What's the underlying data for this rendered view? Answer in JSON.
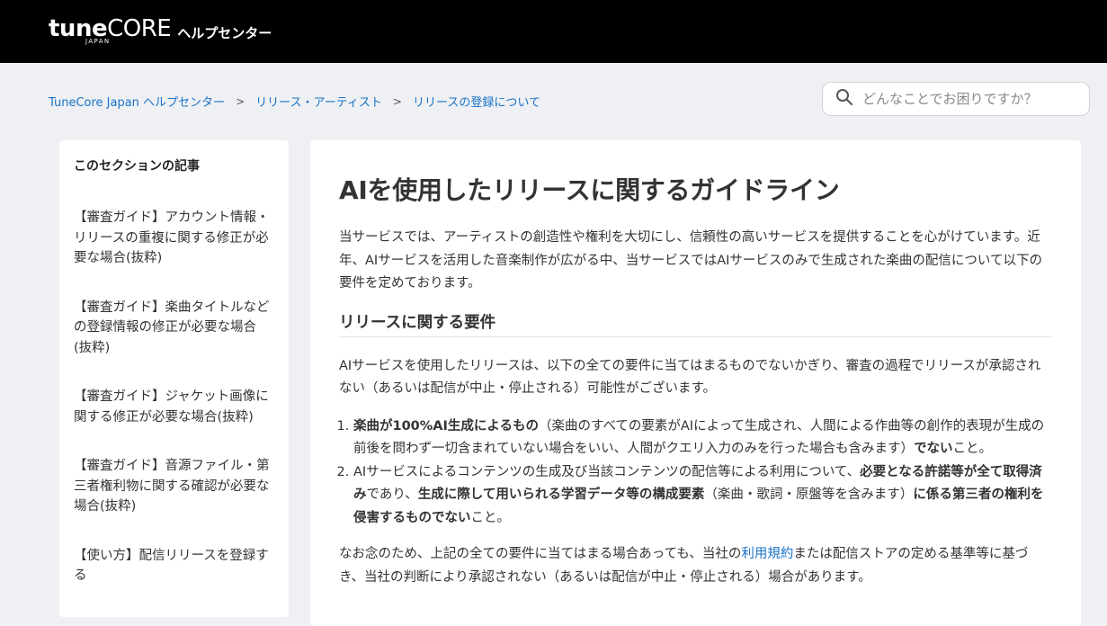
{
  "header": {
    "logo_tune": "tune",
    "logo_core": "CORE",
    "logo_japan": "JAPAN",
    "help_label": "ヘルプセンター"
  },
  "breadcrumb": [
    "TuneCore Japan ヘルプセンター",
    "リリース・アーティスト",
    "リリースの登録について"
  ],
  "breadcrumb_separator": ">",
  "search": {
    "placeholder": "どんなことでお困りですか？"
  },
  "sidebar": {
    "title": "このセクションの記事",
    "items": [
      "【審査ガイド】アカウント情報・リリースの重複に関する修正が必要な場合(抜粋)",
      "【審査ガイド】楽曲タイトルなどの登録情報の修正が必要な場合(抜粋)",
      "【審査ガイド】ジャケット画像に関する修正が必要な場合(抜粋)",
      "【審査ガイド】音源ファイル・第三者権利物に関する確認が必要な場合(抜粋)",
      "【使い方】配信リリースを登録する"
    ]
  },
  "article": {
    "title": "AIを使用したリリースに関するガイドライン",
    "intro": "当サービスでは、アーティストの創造性や権利を大切にし、信頼性の高いサービスを提供することを心がけています。近年、AIサービスを活用した音楽制作が広がる中、当サービスではAIサービスのみで生成された楽曲の配信について以下の要件を定めております。",
    "section_heading": "リリースに関する要件",
    "section_intro": "AIサービスを使用したリリースは、以下の全ての要件に当てはまるものでないかぎり、審査の過程でリリースが承認されない（あるいは配信が中止・停止される）可能性がございます。",
    "req1": {
      "bold_a": "楽曲が100%AI生成によるもの",
      "text_b": "（楽曲のすべての要素がAIによって生成され、人間による作曲等の創作的表現が生成の前後を問わず一切含まれていない場合をいい、人間がクエリ入力のみを行った場合も含みます）",
      "bold_c": "でない",
      "text_d": "こと。"
    },
    "req2": {
      "text_a": "AIサービスによるコンテンツの生成及び当該コンテンツの配信等による利用について、",
      "bold_b": "必要となる許諾等が全て取得済み",
      "text_c": "であり、",
      "bold_d": "生成に際して用いられる学習データ等の構成要素",
      "text_e": "（楽曲・歌詞・原盤等を含みます）",
      "bold_f": "に係る第三者の権利を侵害するものでない",
      "text_g": "こと。"
    },
    "note": {
      "text_a": "なお念のため、上記の全ての要件に当てはまる場合あっても、当社の",
      "link": "利用規約",
      "text_b": "または配信ストアの定める基準等に基づき、当社の判断により承認されない（あるいは配信が中止・停止される）場合があります。"
    }
  },
  "colors": {
    "header_bg": "#000000",
    "page_bg": "#eef0f3",
    "link": "#1a73c8"
  },
  "icons": {
    "search": "search-icon"
  }
}
